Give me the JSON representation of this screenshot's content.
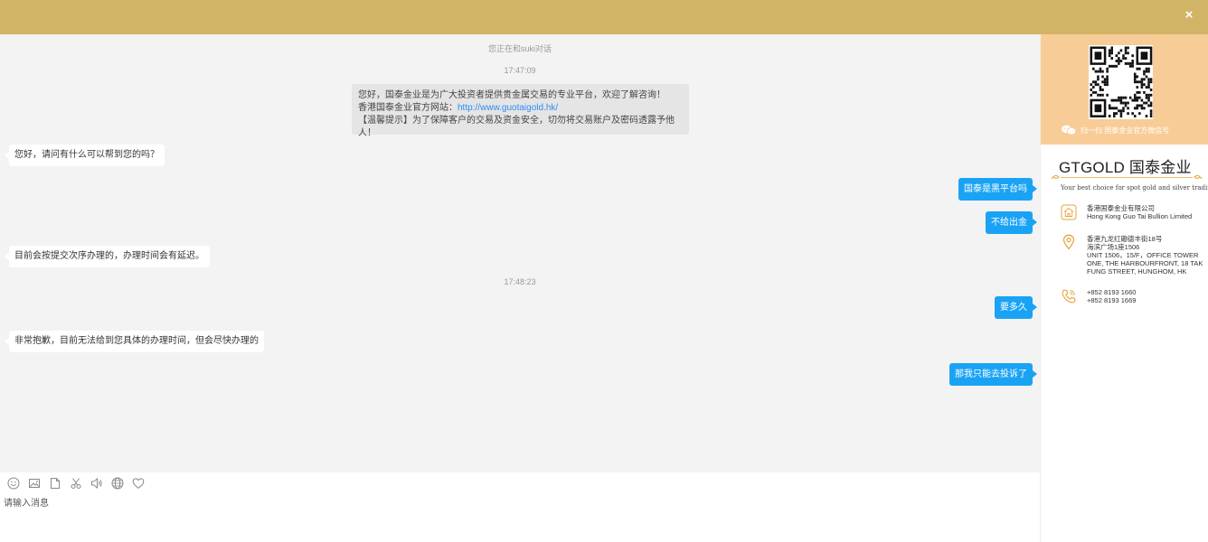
{
  "header": {
    "close_label": "×",
    "bg_color": "#d2b466"
  },
  "chat": {
    "notice": "您正在和suki对话",
    "time_1": "17:47:09",
    "time_2": "17:48:23",
    "welcome": {
      "line1": "您好，国泰金业是为广大投资者提供贵金属交易的专业平台，欢迎了解咨询！",
      "line2_prefix": "香港国泰金业官方网站：",
      "line2_link": "http://www.guotaigold.hk/",
      "line3": "【温馨提示】为了保障客户的交易及资金安全，切勿将交易账户及密码透露予他人！"
    },
    "messages": [
      {
        "side": "agent",
        "text": "您好，请问有什么可以帮到您的吗？"
      },
      {
        "side": "user",
        "text": "国泰是黑平台吗"
      },
      {
        "side": "user",
        "text": "不给出金"
      },
      {
        "side": "agent",
        "text": "目前会按提交次序办理的，办理时间会有延迟。"
      },
      {
        "side": "user",
        "text": "要多久"
      },
      {
        "side": "agent",
        "text": "非常抱歉，目前无法给到您具体的办理时间，但会尽快办理的"
      },
      {
        "side": "user",
        "text": "那我只能去投诉了"
      }
    ],
    "user_bubble_color": "#1aa3f4"
  },
  "composer": {
    "tools": [
      "smile-icon",
      "image-icon",
      "file-icon",
      "scissors-icon",
      "sound-icon",
      "globe-icon",
      "heart-icon"
    ],
    "placeholder": "请输入消息"
  },
  "sidebar": {
    "qr_bg_color": "#f8cc96",
    "wechat_caption": "扫一扫 国泰金业官方微信号",
    "brand_name": "GTGOLD 国泰金业",
    "slogan": "Your best choice for spot gold and silver trading",
    "company": [
      "香港国泰金业有限公司",
      "Hong Kong Guo Tai Bullion Limited"
    ],
    "address": [
      "香港九龙红磡德丰街18号",
      "海滨广场1座1506",
      "UNIT 1506，15/F，OFFICE TOWER",
      "ONE, THE HARBOURFRONT, 18 TAK",
      "FUNG STREET, HUNGHOM, HK"
    ],
    "phones": [
      "+852 8193 1660",
      "+852 8193 1669"
    ],
    "accent_color": "#e6a43c"
  }
}
